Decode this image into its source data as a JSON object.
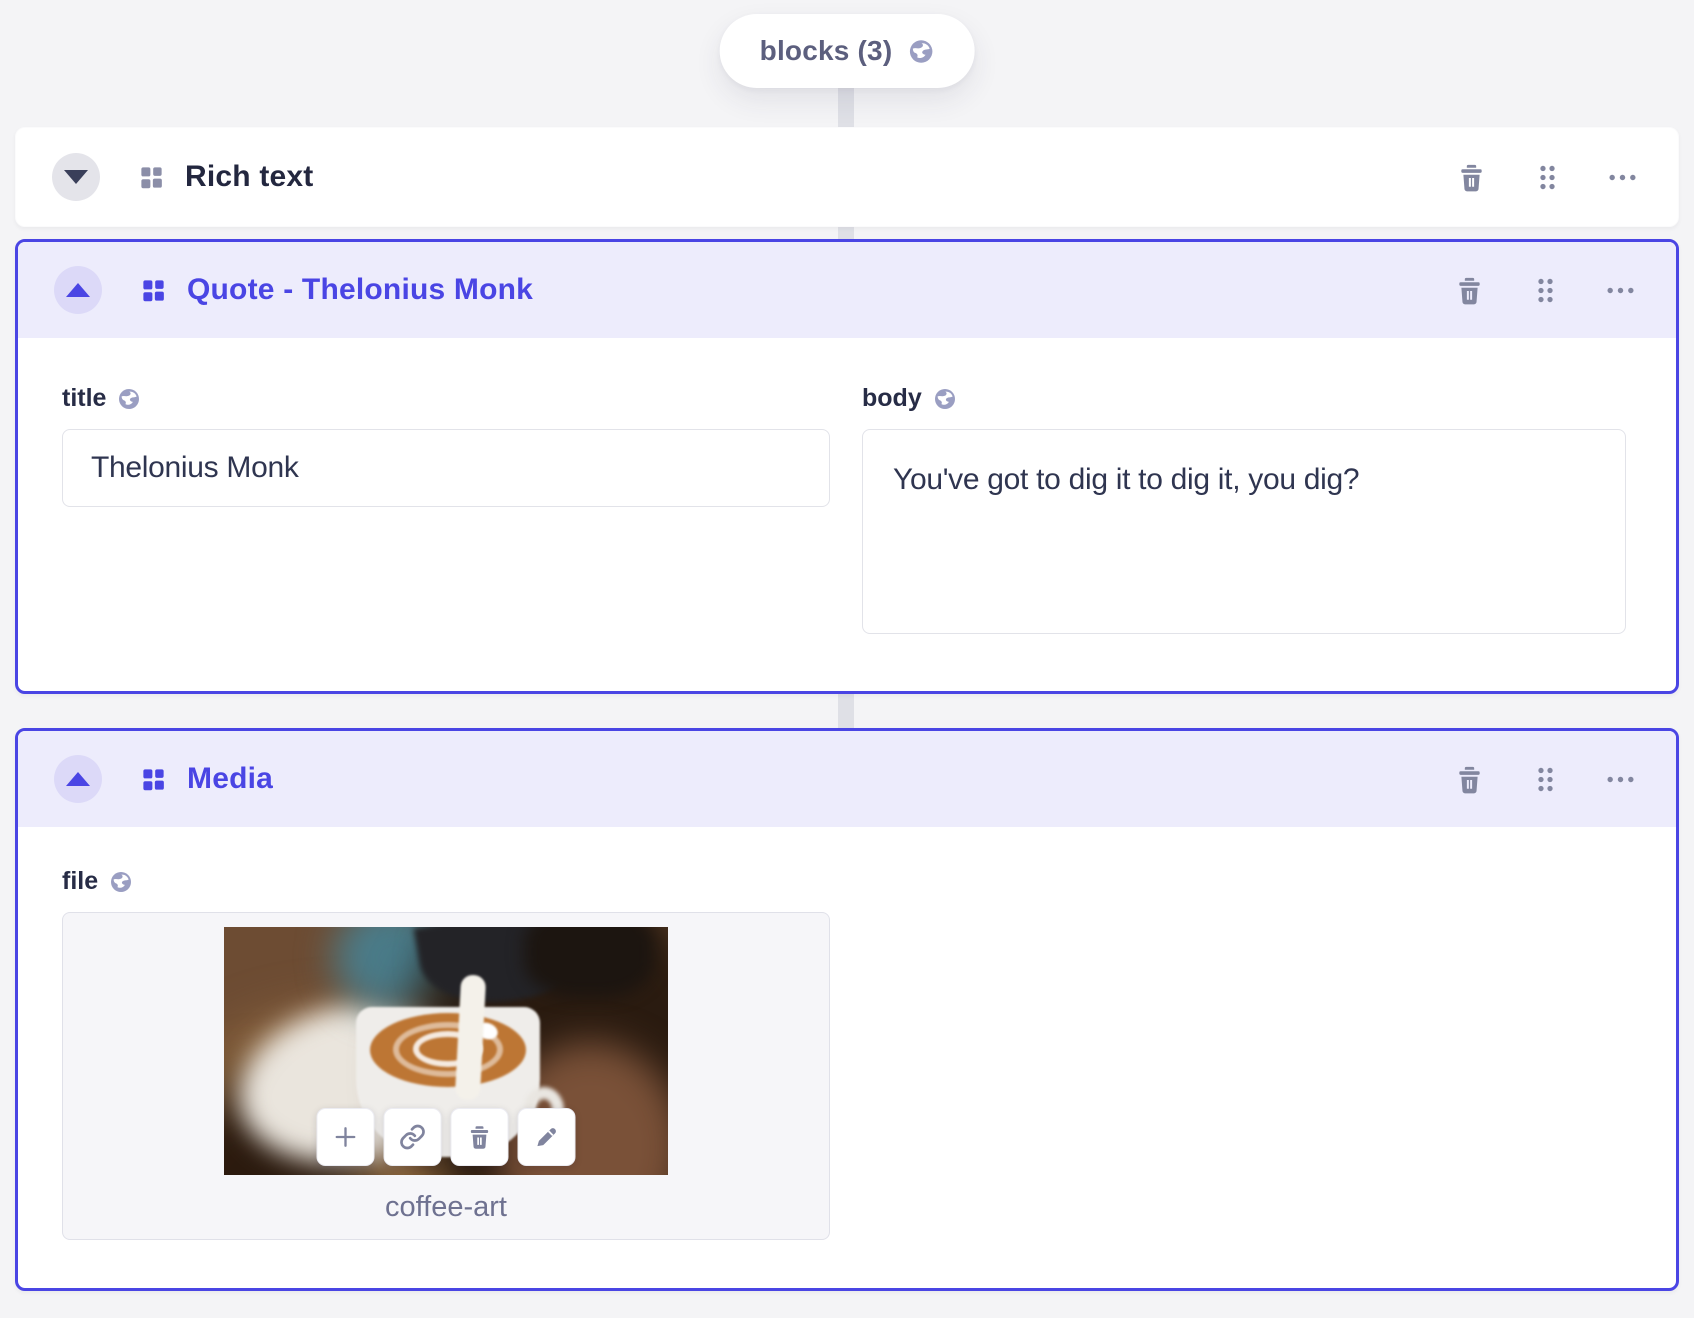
{
  "colors": {
    "accent": "#4a45e4",
    "accent_header_bg": "#edecfc",
    "icon_gray": "#82869f",
    "page_bg": "#f4f4f6"
  },
  "breadcrumb_pill": {
    "label": "blocks (3)",
    "icon": "globe-icon"
  },
  "blocks": {
    "rich_text": {
      "label": "Rich text",
      "collapsed": "true"
    },
    "quote": {
      "label": "Quote - Thelonius Monk",
      "fields": {
        "title": {
          "label": "title",
          "value": "Thelonius Monk",
          "localized_icon": "globe-icon"
        },
        "body": {
          "label": "body",
          "value": "You've got to dig it to dig it, you dig?",
          "localized_icon": "globe-icon"
        }
      }
    },
    "media": {
      "label": "Media",
      "fields": {
        "file": {
          "label": "file",
          "filename": "coffee-art",
          "localized_icon": "globe-icon"
        }
      }
    }
  },
  "icons": {
    "collapse_open": "chevron-up",
    "collapse_closed": "chevron-down",
    "block_type": "grid-2x2",
    "delete": "trash",
    "drag": "six-dots-handle",
    "more": "ellipsis",
    "localized": "globe",
    "media_add": "plus",
    "media_link": "chain-link",
    "media_delete": "trash",
    "media_edit": "pencil"
  }
}
